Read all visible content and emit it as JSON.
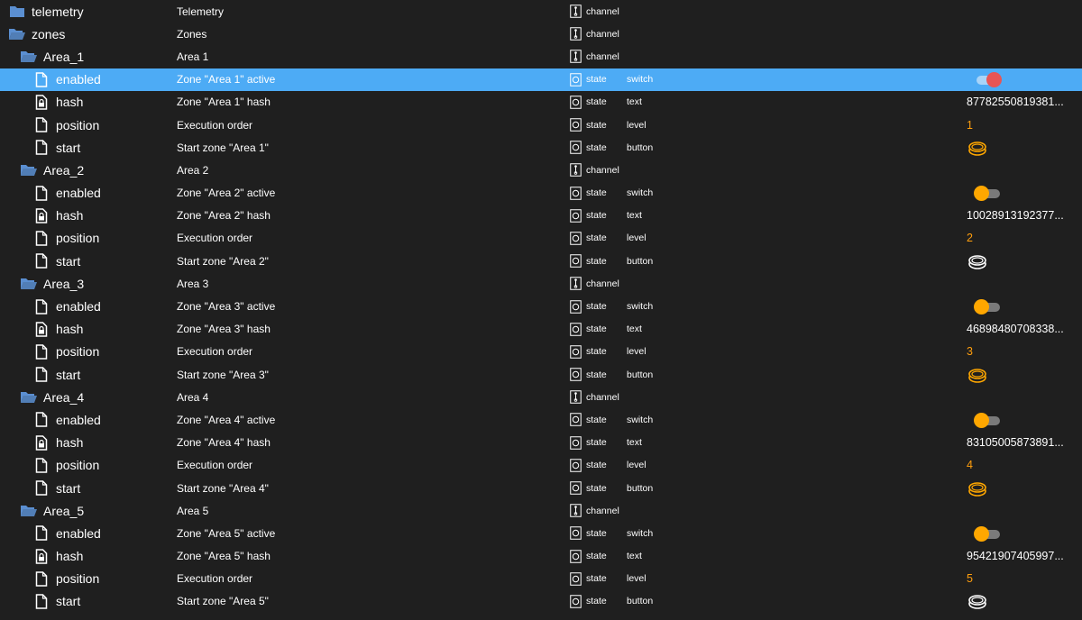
{
  "colors": {
    "background": "#1f1f1f",
    "selected_row": "#4dabf5",
    "folder": "#5b8fd1",
    "level_value": "#ff9e0d",
    "switch_knob_off": "#ffa700",
    "switch_knob_on": "#e75555",
    "button_active": "#ffa700",
    "button_inactive": "#ffffff"
  },
  "rows": [
    {
      "name": "telemetry",
      "kind": "folder",
      "icon": "folder-closed-icon",
      "indent": 0,
      "description": "Telemetry",
      "type": "channel"
    },
    {
      "name": "zones",
      "kind": "folder",
      "icon": "folder-open-icon",
      "indent": 0,
      "description": "Zones",
      "type": "channel"
    },
    {
      "name": "Area_1",
      "kind": "folder",
      "icon": "folder-open-icon",
      "indent": 1,
      "description": "Area 1",
      "type": "channel"
    },
    {
      "name": "enabled",
      "kind": "file",
      "icon": "file-icon",
      "indent": 2,
      "description": "Zone \"Area 1\" active",
      "type": "state",
      "role": "switch",
      "value": true,
      "selected": true
    },
    {
      "name": "hash",
      "kind": "file",
      "icon": "locked-file-icon",
      "indent": 2,
      "description": "Zone \"Area 1\" hash",
      "type": "state",
      "role": "text",
      "value": "87782550819381..."
    },
    {
      "name": "position",
      "kind": "file",
      "icon": "file-icon",
      "indent": 2,
      "description": "Execution order",
      "type": "state",
      "role": "level",
      "value": "1"
    },
    {
      "name": "start",
      "kind": "file",
      "icon": "file-icon",
      "indent": 2,
      "description": "Start zone \"Area 1\"",
      "type": "state",
      "role": "button",
      "value": "active"
    },
    {
      "name": "Area_2",
      "kind": "folder",
      "icon": "folder-open-icon",
      "indent": 1,
      "description": "Area 2",
      "type": "channel"
    },
    {
      "name": "enabled",
      "kind": "file",
      "icon": "file-icon",
      "indent": 2,
      "description": "Zone \"Area 2\" active",
      "type": "state",
      "role": "switch",
      "value": false
    },
    {
      "name": "hash",
      "kind": "file",
      "icon": "locked-file-icon",
      "indent": 2,
      "description": "Zone \"Area 2\" hash",
      "type": "state",
      "role": "text",
      "value": "10028913192377..."
    },
    {
      "name": "position",
      "kind": "file",
      "icon": "file-icon",
      "indent": 2,
      "description": "Execution order",
      "type": "state",
      "role": "level",
      "value": "2"
    },
    {
      "name": "start",
      "kind": "file",
      "icon": "file-icon",
      "indent": 2,
      "description": "Start zone \"Area 2\"",
      "type": "state",
      "role": "button",
      "value": "inactive"
    },
    {
      "name": "Area_3",
      "kind": "folder",
      "icon": "folder-open-icon",
      "indent": 1,
      "description": "Area 3",
      "type": "channel"
    },
    {
      "name": "enabled",
      "kind": "file",
      "icon": "file-icon",
      "indent": 2,
      "description": "Zone \"Area 3\" active",
      "type": "state",
      "role": "switch",
      "value": false
    },
    {
      "name": "hash",
      "kind": "file",
      "icon": "locked-file-icon",
      "indent": 2,
      "description": "Zone \"Area 3\" hash",
      "type": "state",
      "role": "text",
      "value": "46898480708338..."
    },
    {
      "name": "position",
      "kind": "file",
      "icon": "file-icon",
      "indent": 2,
      "description": "Execution order",
      "type": "state",
      "role": "level",
      "value": "3"
    },
    {
      "name": "start",
      "kind": "file",
      "icon": "file-icon",
      "indent": 2,
      "description": "Start zone \"Area 3\"",
      "type": "state",
      "role": "button",
      "value": "active"
    },
    {
      "name": "Area_4",
      "kind": "folder",
      "icon": "folder-open-icon",
      "indent": 1,
      "description": "Area 4",
      "type": "channel"
    },
    {
      "name": "enabled",
      "kind": "file",
      "icon": "file-icon",
      "indent": 2,
      "description": "Zone \"Area 4\" active",
      "type": "state",
      "role": "switch",
      "value": false
    },
    {
      "name": "hash",
      "kind": "file",
      "icon": "locked-file-icon",
      "indent": 2,
      "description": "Zone \"Area 4\" hash",
      "type": "state",
      "role": "text",
      "value": "83105005873891..."
    },
    {
      "name": "position",
      "kind": "file",
      "icon": "file-icon",
      "indent": 2,
      "description": "Execution order",
      "type": "state",
      "role": "level",
      "value": "4"
    },
    {
      "name": "start",
      "kind": "file",
      "icon": "file-icon",
      "indent": 2,
      "description": "Start zone \"Area 4\"",
      "type": "state",
      "role": "button",
      "value": "active"
    },
    {
      "name": "Area_5",
      "kind": "folder",
      "icon": "folder-open-icon",
      "indent": 1,
      "description": "Area 5",
      "type": "channel"
    },
    {
      "name": "enabled",
      "kind": "file",
      "icon": "file-icon",
      "indent": 2,
      "description": "Zone \"Area 5\" active",
      "type": "state",
      "role": "switch",
      "value": false
    },
    {
      "name": "hash",
      "kind": "file",
      "icon": "locked-file-icon",
      "indent": 2,
      "description": "Zone \"Area 5\" hash",
      "type": "state",
      "role": "text",
      "value": "95421907405997..."
    },
    {
      "name": "position",
      "kind": "file",
      "icon": "file-icon",
      "indent": 2,
      "description": "Execution order",
      "type": "state",
      "role": "level",
      "value": "5"
    },
    {
      "name": "start",
      "kind": "file",
      "icon": "file-icon",
      "indent": 2,
      "description": "Start zone \"Area 5\"",
      "type": "state",
      "role": "button",
      "value": "inactive"
    }
  ]
}
